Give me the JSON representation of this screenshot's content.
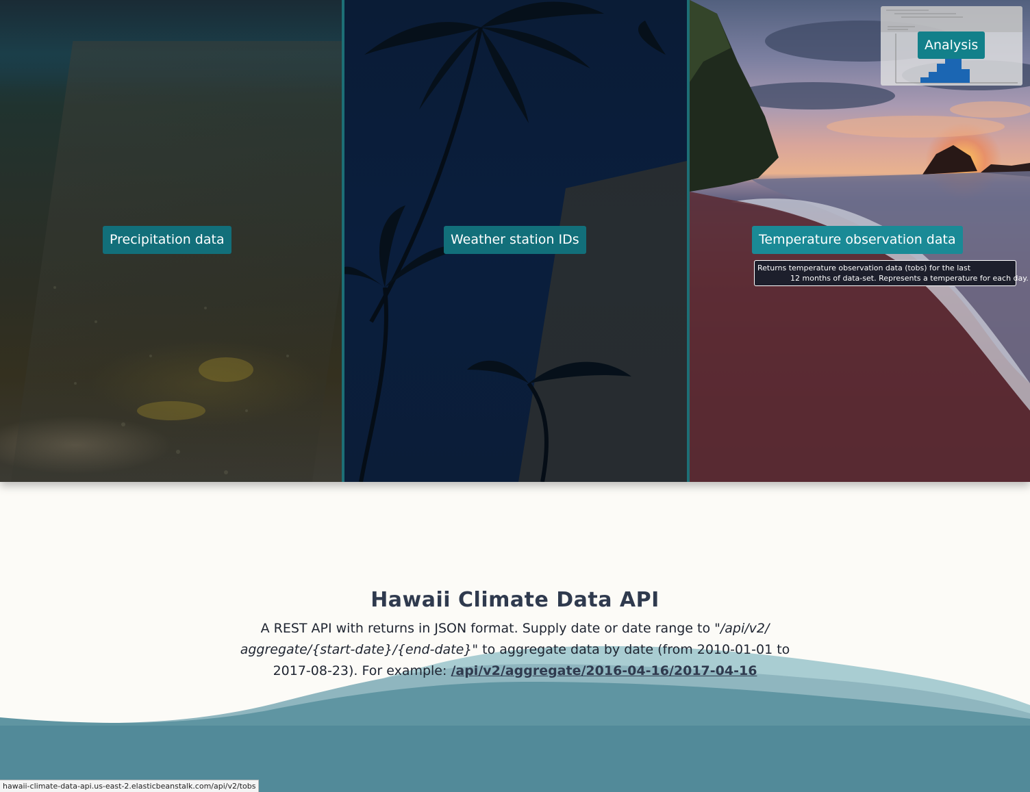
{
  "hero": {
    "panels": [
      {
        "label": "Precipitation data"
      },
      {
        "label": "Weather station IDs"
      },
      {
        "label": "Temperature observation data"
      }
    ],
    "tooltip": {
      "line1": "Returns temperature observation data (tobs) for the last",
      "line2": "12 months of data-set. Represents a temperature for each day."
    },
    "analysis": {
      "label": "Analysis"
    }
  },
  "main": {
    "title": "Hawaii Climate Data API",
    "description_pre": "A REST API with returns in JSON format. Supply date or date range to ",
    "description_route": "\"/api/v2/ aggregate/{start-date}/{end-date}\"",
    "description_mid": " to aggregate data by date (from 2010-01-01 to 2017-08-23). For example: ",
    "example_link": "/api/v2/aggregate/2016-04-16/2017-04-16"
  },
  "status_bar": {
    "url": "hawaii-climate-data-api.us-east-2.elasticbeanstalk.com/api/v2/tobs"
  },
  "colors": {
    "button": "#126f7a",
    "button_hover": "#1a8a96",
    "divider": "#1d6f76",
    "title": "#2f3a4e",
    "wave_dark": "#528a99",
    "wave_light": "#9cc2c8",
    "page_bg": "#fcfbf7"
  }
}
